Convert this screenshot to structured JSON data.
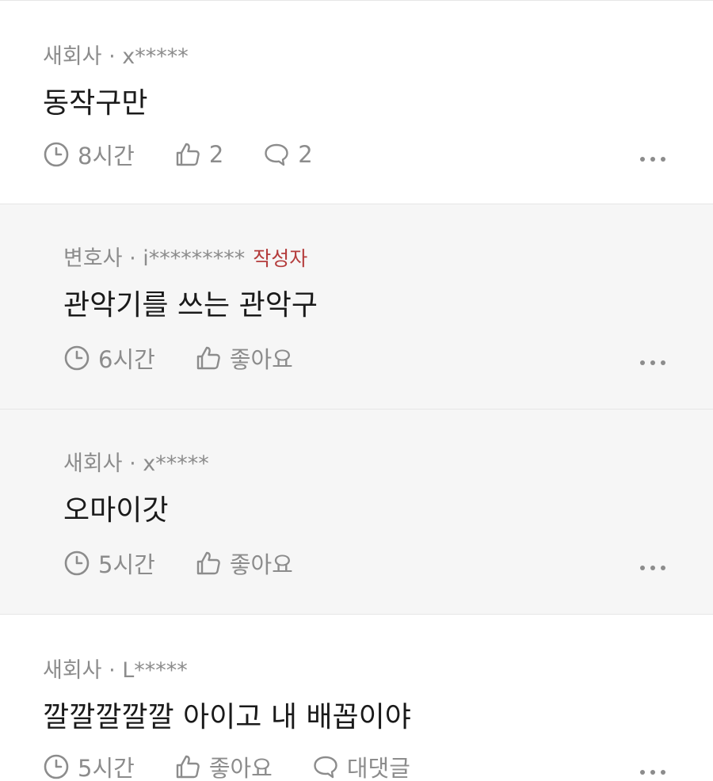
{
  "comments": [
    {
      "author": "새회사 · x*****",
      "badge": "",
      "text": "동작구만",
      "time": "8시간",
      "likes": "2",
      "replies": "2",
      "is_reply": false
    },
    {
      "author": "변호사 · i*********",
      "badge": "작성자",
      "text": "관악기를 쓰는 관악구",
      "time": "6시간",
      "likes": "좋아요",
      "is_reply": true
    },
    {
      "author": "새회사 · x*****",
      "badge": "",
      "text": "오마이갓",
      "time": "5시간",
      "likes": "좋아요",
      "is_reply": true
    },
    {
      "author": "새회사 · L*****",
      "badge": "",
      "text": "깔깔깔깔깔 아이고 내 배꼽이야",
      "time": "5시간",
      "likes": "좋아요",
      "replies": "대댓글",
      "is_reply": false
    }
  ],
  "colors": {
    "meta_text": "#8c8c8c",
    "body_text": "#1a1a1a",
    "author_badge": "#b43c3c",
    "reply_background": "#f6f6f6",
    "divider": "#e6e6e6"
  },
  "icons": {
    "time": "clock-icon",
    "like": "thumbs-up-icon",
    "reply": "speech-bubble-icon",
    "more": "more-dots-icon"
  }
}
